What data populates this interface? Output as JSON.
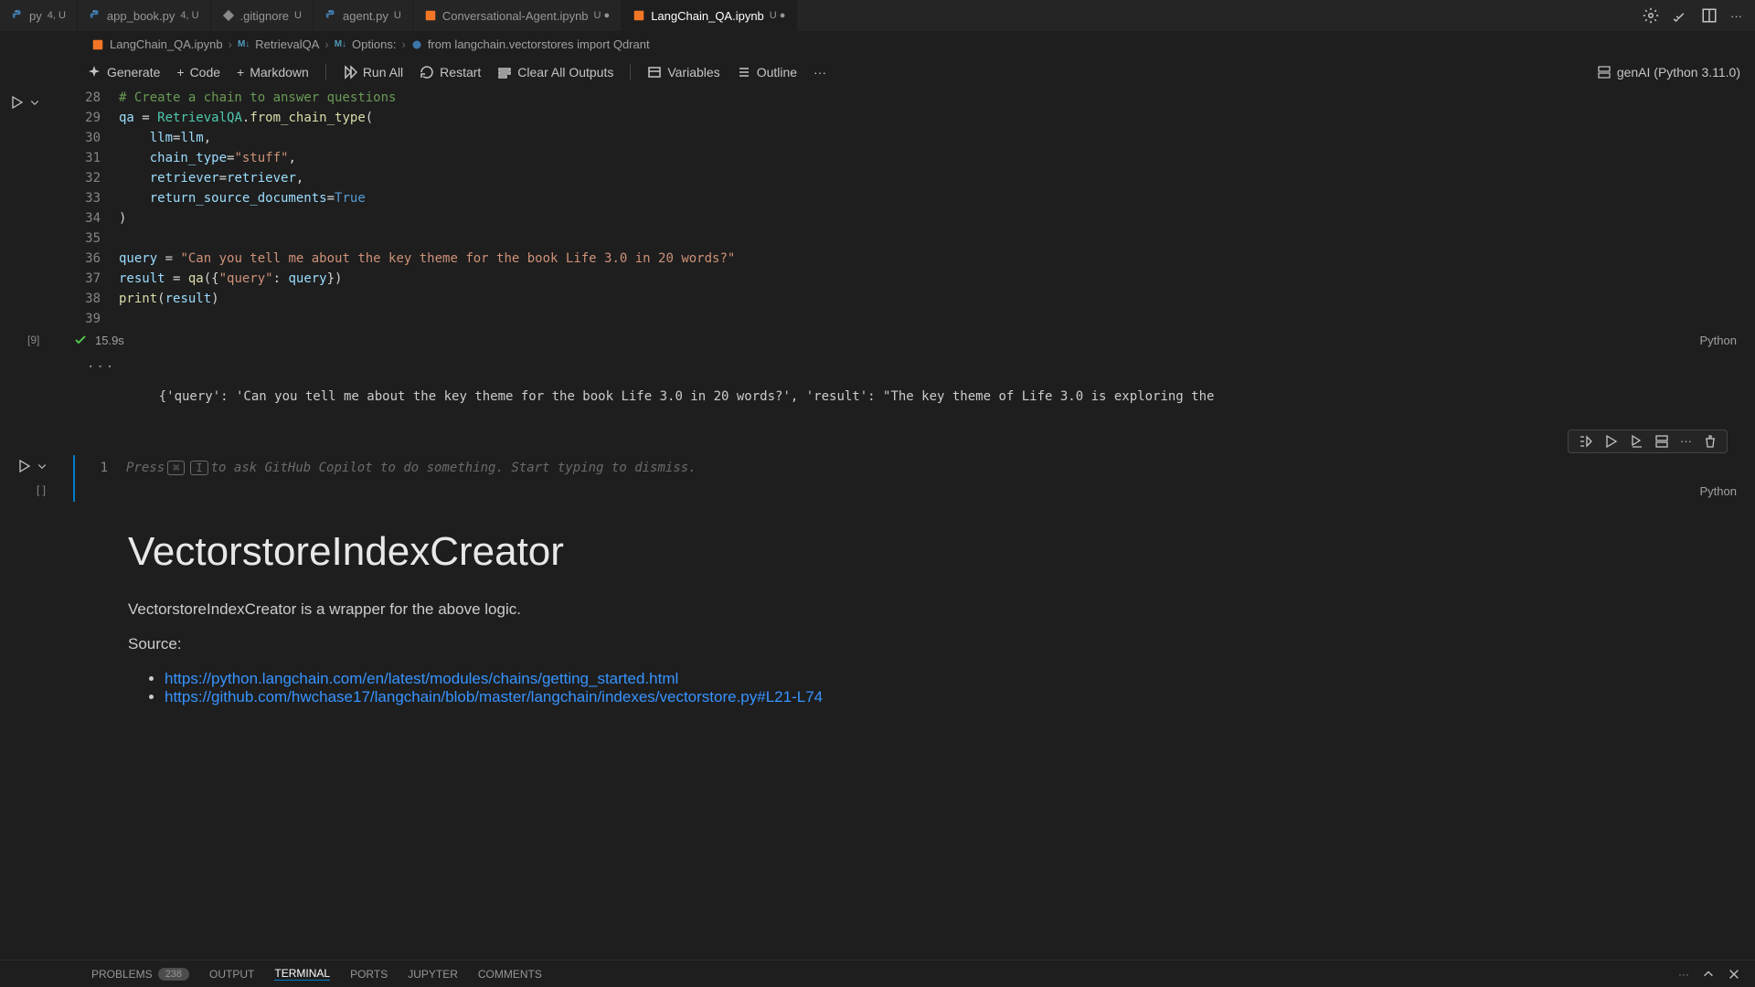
{
  "tabs": [
    {
      "name": "py",
      "badge": "4, U",
      "icon": "python"
    },
    {
      "name": "app_book.py",
      "badge": "4, U",
      "icon": "python"
    },
    {
      "name": ".gitignore",
      "badge": "U",
      "icon": "git"
    },
    {
      "name": "agent.py",
      "badge": "U",
      "icon": "python"
    },
    {
      "name": "Conversational-Agent.ipynb",
      "badge": "U ●",
      "icon": "notebook"
    },
    {
      "name": "LangChain_QA.ipynb",
      "badge": "U ●",
      "icon": "notebook",
      "active": true
    }
  ],
  "breadcrumb": {
    "items": [
      {
        "label": "LangChain_QA.ipynb",
        "icon": "notebook"
      },
      {
        "label": "RetrievalQA",
        "icon": "md"
      },
      {
        "label": "Options:",
        "icon": "md"
      },
      {
        "label": "from langchain.vectorstores import Qdrant",
        "icon": "py"
      }
    ]
  },
  "toolbar": {
    "generate": "Generate",
    "code": "Code",
    "markdown": "Markdown",
    "run_all": "Run All",
    "restart": "Restart",
    "clear": "Clear All Outputs",
    "variables": "Variables",
    "outline": "Outline",
    "kernel": "genAI (Python 3.11.0)"
  },
  "code": {
    "lines": [
      {
        "n": "28",
        "tokens": [
          {
            "c": "c-comment",
            "t": "# Create a chain to answer questions"
          }
        ]
      },
      {
        "n": "29",
        "tokens": [
          {
            "c": "c-ident",
            "t": "qa"
          },
          {
            "c": "c-default",
            "t": " = "
          },
          {
            "c": "c-type",
            "t": "RetrievalQA"
          },
          {
            "c": "c-default",
            "t": "."
          },
          {
            "c": "c-func",
            "t": "from_chain_type"
          },
          {
            "c": "c-punct",
            "t": "("
          }
        ]
      },
      {
        "n": "30",
        "indent": true,
        "tokens": [
          {
            "c": "c-ident",
            "t": "llm"
          },
          {
            "c": "c-default",
            "t": "="
          },
          {
            "c": "c-ident",
            "t": "llm"
          },
          {
            "c": "c-punct",
            "t": ","
          }
        ]
      },
      {
        "n": "31",
        "indent": true,
        "tokens": [
          {
            "c": "c-ident",
            "t": "chain_type"
          },
          {
            "c": "c-default",
            "t": "="
          },
          {
            "c": "c-str",
            "t": "\"stuff\""
          },
          {
            "c": "c-punct",
            "t": ","
          }
        ]
      },
      {
        "n": "32",
        "indent": true,
        "tokens": [
          {
            "c": "c-ident",
            "t": "retriever"
          },
          {
            "c": "c-default",
            "t": "="
          },
          {
            "c": "c-ident",
            "t": "retriever"
          },
          {
            "c": "c-punct",
            "t": ","
          }
        ]
      },
      {
        "n": "33",
        "indent": true,
        "tokens": [
          {
            "c": "c-ident",
            "t": "return_source_documents"
          },
          {
            "c": "c-default",
            "t": "="
          },
          {
            "c": "c-kw",
            "t": "True"
          }
        ]
      },
      {
        "n": "34",
        "tokens": [
          {
            "c": "c-punct",
            "t": ")"
          }
        ]
      },
      {
        "n": "35",
        "tokens": []
      },
      {
        "n": "36",
        "tokens": [
          {
            "c": "c-ident",
            "t": "query"
          },
          {
            "c": "c-default",
            "t": " = "
          },
          {
            "c": "c-str",
            "t": "\"Can you tell me about the key theme for the book Life 3.0 in 20 words?\""
          }
        ]
      },
      {
        "n": "37",
        "tokens": [
          {
            "c": "c-ident",
            "t": "result"
          },
          {
            "c": "c-default",
            "t": " = "
          },
          {
            "c": "c-func",
            "t": "qa"
          },
          {
            "c": "c-punct",
            "t": "({"
          },
          {
            "c": "c-str",
            "t": "\"query\""
          },
          {
            "c": "c-punct",
            "t": ": "
          },
          {
            "c": "c-ident",
            "t": "query"
          },
          {
            "c": "c-punct",
            "t": "})"
          }
        ]
      },
      {
        "n": "38",
        "tokens": [
          {
            "c": "c-func",
            "t": "print"
          },
          {
            "c": "c-punct",
            "t": "("
          },
          {
            "c": "c-ident",
            "t": "result"
          },
          {
            "c": "c-punct",
            "t": ")"
          }
        ]
      },
      {
        "n": "39",
        "tokens": []
      }
    ]
  },
  "cell_status": {
    "exec_count": "[9]",
    "time": "15.9s",
    "lang": "Python"
  },
  "output": "{'query': 'Can you tell me about the key theme for the book Life 3.0 in 20 words?', 'result': \"The key theme of Life 3.0 is exploring the",
  "copilot": {
    "line_no": "1",
    "prefix": "Press ",
    "key1": "⌘",
    "key2": "I",
    "suffix": " to ask GitHub Copilot to do something. Start typing to dismiss."
  },
  "new_cell": {
    "exec": "[ ]",
    "lang": "Python"
  },
  "markdown": {
    "heading": "VectorstoreIndexCreator",
    "desc": "VectorstoreIndexCreator is a wrapper for the above logic.",
    "source_label": "Source:",
    "links": [
      "https://python.langchain.com/en/latest/modules/chains/getting_started.html",
      "https://github.com/hwchase17/langchain/blob/master/langchain/indexes/vectorstore.py#L21-L74"
    ]
  },
  "panel": {
    "tabs": [
      "PROBLEMS",
      "OUTPUT",
      "TERMINAL",
      "PORTS",
      "JUPYTER",
      "COMMENTS"
    ],
    "problems_badge": "238",
    "active": "TERMINAL"
  }
}
